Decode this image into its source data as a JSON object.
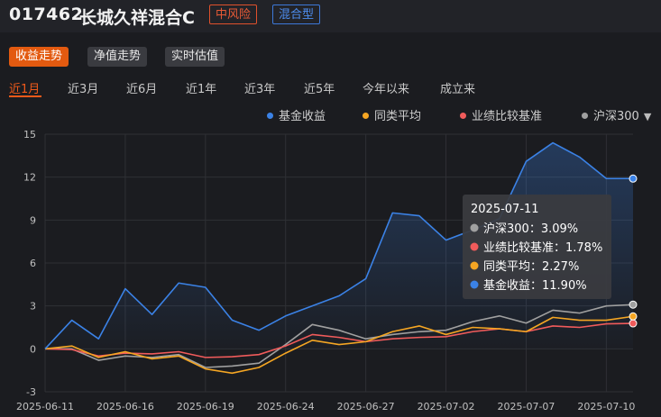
{
  "fund": {
    "code": "017462",
    "name": "长城久祥混合C",
    "risk_tag": "中风险",
    "type_tag": "混合型"
  },
  "view_tabs": [
    {
      "label": "收益走势",
      "active": true
    },
    {
      "label": "净值走势",
      "active": false
    },
    {
      "label": "实时估值",
      "active": false
    }
  ],
  "period_tabs": [
    {
      "label": "近1月",
      "active": true
    },
    {
      "label": "近3月",
      "active": false
    },
    {
      "label": "近6月",
      "active": false
    },
    {
      "label": "近1年",
      "active": false
    },
    {
      "label": "近3年",
      "active": false
    },
    {
      "label": "近5年",
      "active": false
    },
    {
      "label": "今年以来",
      "active": false
    },
    {
      "label": "成立来",
      "active": false
    }
  ],
  "legend": [
    {
      "label": "基金收益",
      "color": "#3b82e6"
    },
    {
      "label": "同类平均",
      "color": "#f5a623"
    },
    {
      "label": "业绩比较基准",
      "color": "#f05b5b"
    },
    {
      "label": "沪深300",
      "color": "#a0a0a0"
    }
  ],
  "tooltip": {
    "date": "2025-07-11",
    "rows": [
      {
        "text": "沪深300：3.09%",
        "color": "#a0a0a0"
      },
      {
        "text": "业绩比较基准：1.78%",
        "color": "#f05b5b"
      },
      {
        "text": "同类平均：2.27%",
        "color": "#f5a623"
      },
      {
        "text": "基金收益：11.90%",
        "color": "#3b82e6"
      }
    ]
  },
  "chart_data": {
    "type": "line",
    "x": [
      "2025-06-11",
      "2025-06-12",
      "2025-06-13",
      "2025-06-16",
      "2025-06-17",
      "2025-06-18",
      "2025-06-19",
      "2025-06-20",
      "2025-06-23",
      "2025-06-24",
      "2025-06-25",
      "2025-06-26",
      "2025-06-27",
      "2025-06-30",
      "2025-07-01",
      "2025-07-02",
      "2025-07-03",
      "2025-07-04",
      "2025-07-07",
      "2025-07-08",
      "2025-07-09",
      "2025-07-10",
      "2025-07-11"
    ],
    "x_tick_labels": [
      "2025-06-11",
      "2025-06-16",
      "2025-06-19",
      "2025-06-24",
      "2025-06-27",
      "2025-07-02",
      "2025-07-07",
      "2025-07-10"
    ],
    "x_tick_indices": [
      0,
      3,
      6,
      9,
      12,
      15,
      18,
      21
    ],
    "ylim": [
      -3,
      15
    ],
    "yticks": [
      -3,
      0,
      3,
      6,
      9,
      12,
      15
    ],
    "series": [
      {
        "name": "基金收益",
        "color": "#3b82e6",
        "values": [
          0.0,
          2.0,
          0.7,
          4.2,
          2.4,
          4.6,
          4.3,
          2.0,
          1.3,
          2.3,
          3.0,
          3.7,
          4.9,
          9.5,
          9.3,
          7.6,
          8.3,
          9.1,
          13.1,
          14.4,
          13.4,
          11.9,
          11.9
        ]
      },
      {
        "name": "同类平均",
        "color": "#f5a623",
        "values": [
          0.0,
          0.2,
          -0.6,
          -0.2,
          -0.7,
          -0.5,
          -1.4,
          -1.7,
          -1.3,
          -0.3,
          0.6,
          0.3,
          0.5,
          1.2,
          1.6,
          1.0,
          1.5,
          1.4,
          1.2,
          2.2,
          2.0,
          2.0,
          2.27
        ]
      },
      {
        "name": "业绩比较基准",
        "color": "#f05b5b",
        "values": [
          0.0,
          -0.05,
          -0.5,
          -0.3,
          -0.35,
          -0.2,
          -0.6,
          -0.55,
          -0.4,
          0.2,
          1.0,
          0.8,
          0.5,
          0.7,
          0.8,
          0.85,
          1.2,
          1.4,
          1.2,
          1.6,
          1.5,
          1.75,
          1.78
        ]
      },
      {
        "name": "沪深300",
        "color": "#a0a0a0",
        "values": [
          0.0,
          0.0,
          -0.8,
          -0.5,
          -0.6,
          -0.4,
          -1.3,
          -1.2,
          -1.0,
          0.3,
          1.7,
          1.3,
          0.7,
          1.0,
          1.2,
          1.3,
          1.9,
          2.3,
          1.8,
          2.7,
          2.5,
          3.0,
          3.09
        ]
      }
    ]
  },
  "colors": {
    "accent": "#e35a10",
    "background": "#1b1c20"
  }
}
